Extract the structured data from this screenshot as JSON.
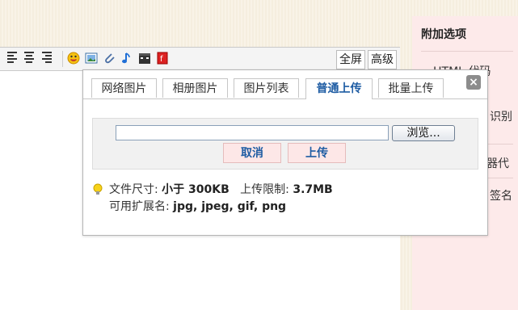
{
  "toolbar": {
    "fullscreen_label": "全屏",
    "advanced_label": "高级"
  },
  "right_panel": {
    "title": "附加选项",
    "fragments": [
      "HTML 代码",
      "识别",
      "器代",
      "签名"
    ]
  },
  "dialog": {
    "tabs": [
      {
        "label": "网络图片",
        "active": false
      },
      {
        "label": "相册图片",
        "active": false
      },
      {
        "label": "图片列表",
        "active": false
      },
      {
        "label": "普通上传",
        "active": true
      },
      {
        "label": "批量上传",
        "active": false
      }
    ],
    "close_label": "×",
    "upload": {
      "file_value": "",
      "browse_label": "浏览...",
      "cancel_label": "取消",
      "upload_label": "上传"
    },
    "info": {
      "size_label": "文件尺寸:",
      "size_value": "小于 300KB",
      "limit_label": "上传限制:",
      "limit_value": "3.7MB",
      "ext_label": "可用扩展名:",
      "ext_value": "jpg, jpeg, gif, png"
    }
  },
  "colors": {
    "active_tab": "#1e5ca3",
    "button_bg": "#fde7e7",
    "panel_bg": "#fdeaea"
  }
}
